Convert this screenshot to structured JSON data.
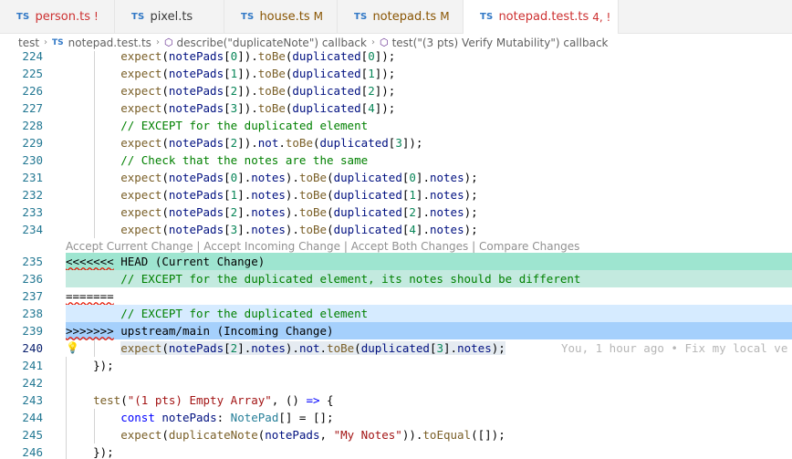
{
  "tabs": [
    {
      "label": "person.ts",
      "status": "!",
      "state": "error",
      "icon": "typescript-icon"
    },
    {
      "label": "pixel.ts",
      "status": "",
      "state": "normal",
      "icon": "typescript-icon"
    },
    {
      "label": "house.ts",
      "status": "M",
      "state": "modified",
      "icon": "typescript-icon"
    },
    {
      "label": "notepad.ts",
      "status": "M",
      "state": "modified",
      "icon": "typescript-icon"
    },
    {
      "label": "notepad.test.ts",
      "status": "4, !",
      "state": "error",
      "icon": "typescript-icon",
      "active": true
    }
  ],
  "tab_icon_text": "TS",
  "breadcrumb": {
    "folder": "test",
    "file": "notepad.test.ts",
    "symbol1": "describe(\"duplicateNote\") callback",
    "symbol2": "test(\"(3 pts) Verify Mutability\") callback"
  },
  "codelens": {
    "accept_current": "Accept Current Change",
    "accept_incoming": "Accept Incoming Change",
    "accept_both": "Accept Both Changes",
    "compare": "Compare Changes",
    "separator": " | "
  },
  "blame": "You, 1 hour ago • Fix my local ve",
  "lines": [
    {
      "n": "224",
      "text": "        expect(notePads[0]).toBe(duplicated[0]);"
    },
    {
      "n": "225",
      "text": "        expect(notePads[1]).toBe(duplicated[1]);"
    },
    {
      "n": "226",
      "text": "        expect(notePads[2]).toBe(duplicated[2]);"
    },
    {
      "n": "227",
      "text": "        expect(notePads[3]).toBe(duplicated[4]);"
    },
    {
      "n": "228",
      "text": "        // EXCEPT for the duplicated element"
    },
    {
      "n": "229",
      "text": "        expect(notePads[2]).not.toBe(duplicated[3]);"
    },
    {
      "n": "230",
      "text": "        // Check that the notes are the same"
    },
    {
      "n": "231",
      "text": "        expect(notePads[0].notes).toBe(duplicated[0].notes);"
    },
    {
      "n": "232",
      "text": "        expect(notePads[1].notes).toBe(duplicated[1].notes);"
    },
    {
      "n": "233",
      "text": "        expect(notePads[2].notes).toBe(duplicated[2].notes);"
    },
    {
      "n": "234",
      "text": "        expect(notePads[3].notes).toBe(duplicated[4].notes);"
    },
    {
      "n": "235",
      "text": "<<<<<<< HEAD (Current Change)"
    },
    {
      "n": "236",
      "text": "        // EXCEPT for the duplicated element, its notes should be different"
    },
    {
      "n": "237",
      "text": "======="
    },
    {
      "n": "238",
      "text": "        // EXCEPT for the duplicated element"
    },
    {
      "n": "239",
      "text": ">>>>>>> upstream/main (Incoming Change)"
    },
    {
      "n": "240",
      "text": "        expect(notePads[2].notes).not.toBe(duplicated[3].notes);"
    },
    {
      "n": "241",
      "text": "    });"
    },
    {
      "n": "242",
      "text": ""
    },
    {
      "n": "243",
      "text": "    test(\"(1 pts) Empty Array\", () => {"
    },
    {
      "n": "244",
      "text": "        const notePads: NotePad[] = [];"
    },
    {
      "n": "245",
      "text": "        expect(duplicateNote(notePads, \"My Notes\")).toEqual([]);"
    },
    {
      "n": "246",
      "text": "    });"
    }
  ],
  "colors": {
    "current_header": "#9ee5d0",
    "current_body": "#c3eadf",
    "incoming_header": "#a5d0fc",
    "incoming_body": "#d6ebff",
    "line_number": "#237893",
    "comment": "#008000",
    "function": "#795e26",
    "variable": "#001080",
    "ts_icon": "#3178c6",
    "error": "#cd3131",
    "modified": "#895503"
  }
}
